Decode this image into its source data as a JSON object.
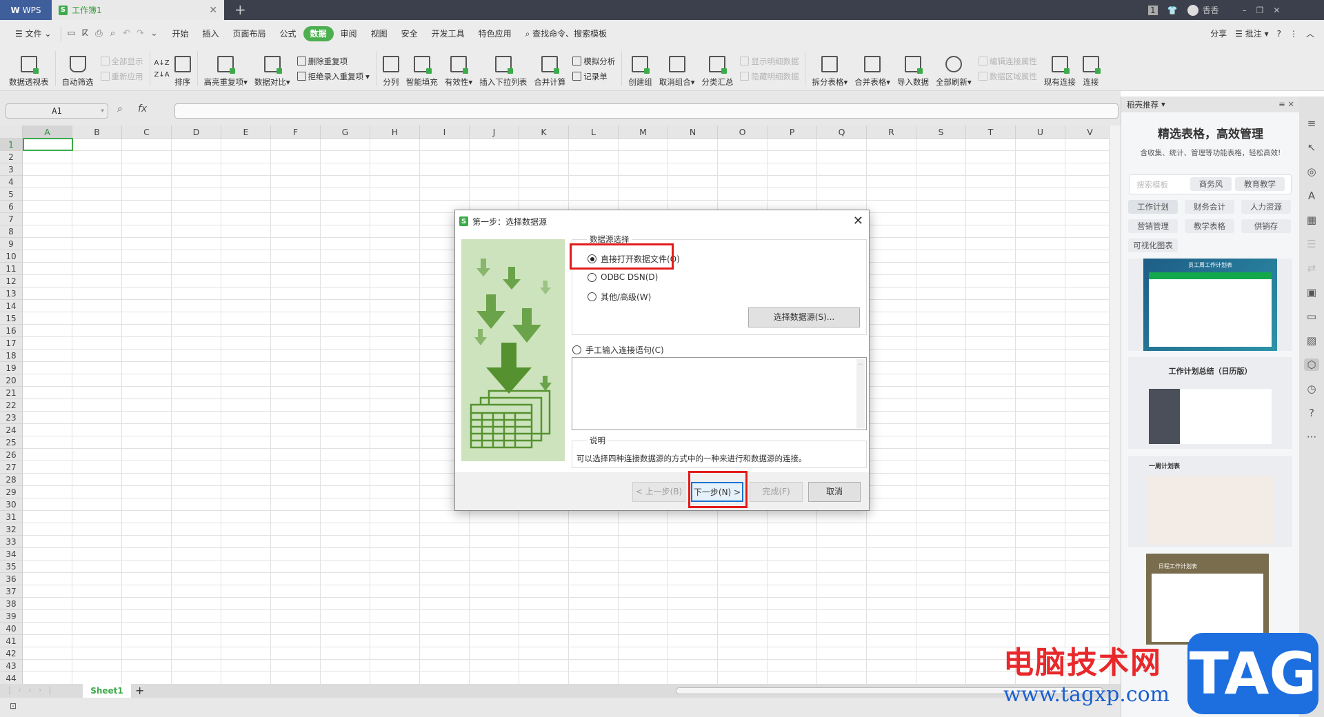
{
  "titlebar": {
    "app": "WPS",
    "doc_tab": "工作簿1",
    "user": "香香",
    "badge": "1"
  },
  "menu": {
    "file": "文件",
    "tabs": [
      "开始",
      "插入",
      "页面布局",
      "公式",
      "数据",
      "审阅",
      "视图",
      "安全",
      "开发工具",
      "特色应用"
    ],
    "active": "数据",
    "search": "查找命令、搜索模板",
    "share": "分享",
    "comment": "批注",
    "help": "?"
  },
  "ribbon": {
    "pivot": "数据透视表",
    "autofilter": "自动筛选",
    "show_all": "全部显示",
    "reapply": "重新应用",
    "sort": "排序",
    "highlight_dup": "高亮重复项",
    "compare": "数据对比",
    "remove_dup": "删除重复项",
    "reject_dup": "拒绝录入重复项",
    "split_col": "分列",
    "smart_fill": "智能填充",
    "validity": "有效性",
    "insert_dropdown": "插入下拉列表",
    "consolidate": "合并计算",
    "simulate": "模拟分析",
    "record": "记录单",
    "group": "创建组",
    "ungroup": "取消组合",
    "subtotal": "分类汇总",
    "show_detail": "显示明细数据",
    "hide_detail": "隐藏明细数据",
    "split_table": "拆分表格",
    "merge_table": "合并表格",
    "import": "导入数据",
    "refresh_all": "全部刷新",
    "edit_conn": "编辑连接属性",
    "range_prop": "数据区域属性",
    "existing_conn": "现有连接",
    "connect": "连接"
  },
  "formula": {
    "namebox": "A1",
    "fx": "fx",
    "value": ""
  },
  "grid": {
    "columns": [
      "A",
      "B",
      "C",
      "D",
      "E",
      "F",
      "G",
      "H",
      "I",
      "J",
      "K",
      "L",
      "M",
      "N",
      "O",
      "P",
      "Q",
      "R",
      "S",
      "T",
      "U",
      "V"
    ],
    "row_count": 44,
    "selected": "A1"
  },
  "sheets": {
    "tabs": [
      "Sheet1"
    ],
    "add": "+"
  },
  "panel": {
    "title": "稻壳推荐",
    "headline": "精选表格，高效管理",
    "subtitle": "含收集、统计、管理等功能表格，轻松高效!",
    "search_placeholder": "搜索模板",
    "search_tags": [
      "商务风",
      "教育教学"
    ],
    "tags": [
      "工作计划",
      "财务会计",
      "人力资源",
      "营销管理",
      "教学表格",
      "供销存",
      "可视化图表"
    ],
    "cards": [
      "员工周工作计划表",
      "工作计划总结（日历版）",
      "一周计划表",
      "日程工作计划表"
    ]
  },
  "dialog": {
    "title": "第一步：选择数据源",
    "group_label": "数据源选择",
    "options": [
      "直接打开数据文件(O)",
      "ODBC DSN(D)",
      "其他/高级(W)"
    ],
    "selected_option": 0,
    "select_source": "选择数据源(S)...",
    "manual_option": "手工输入连接语句(C)",
    "manual_text": "",
    "desc_label": "说明",
    "desc": "可以选择四种连接数据源的方式中的一种来进行和数据源的连接。",
    "buttons": {
      "prev": "< 上一步(B)",
      "next": "下一步(N) >",
      "finish": "完成(F)",
      "cancel": "取消"
    }
  },
  "watermark": {
    "site_name": "电脑技术网",
    "url": "www.tagxp.com",
    "logo": "TAG"
  },
  "colors": {
    "accent": "#4caf50",
    "highlight": "#e31b1b",
    "titlebar": "#3c404d"
  }
}
